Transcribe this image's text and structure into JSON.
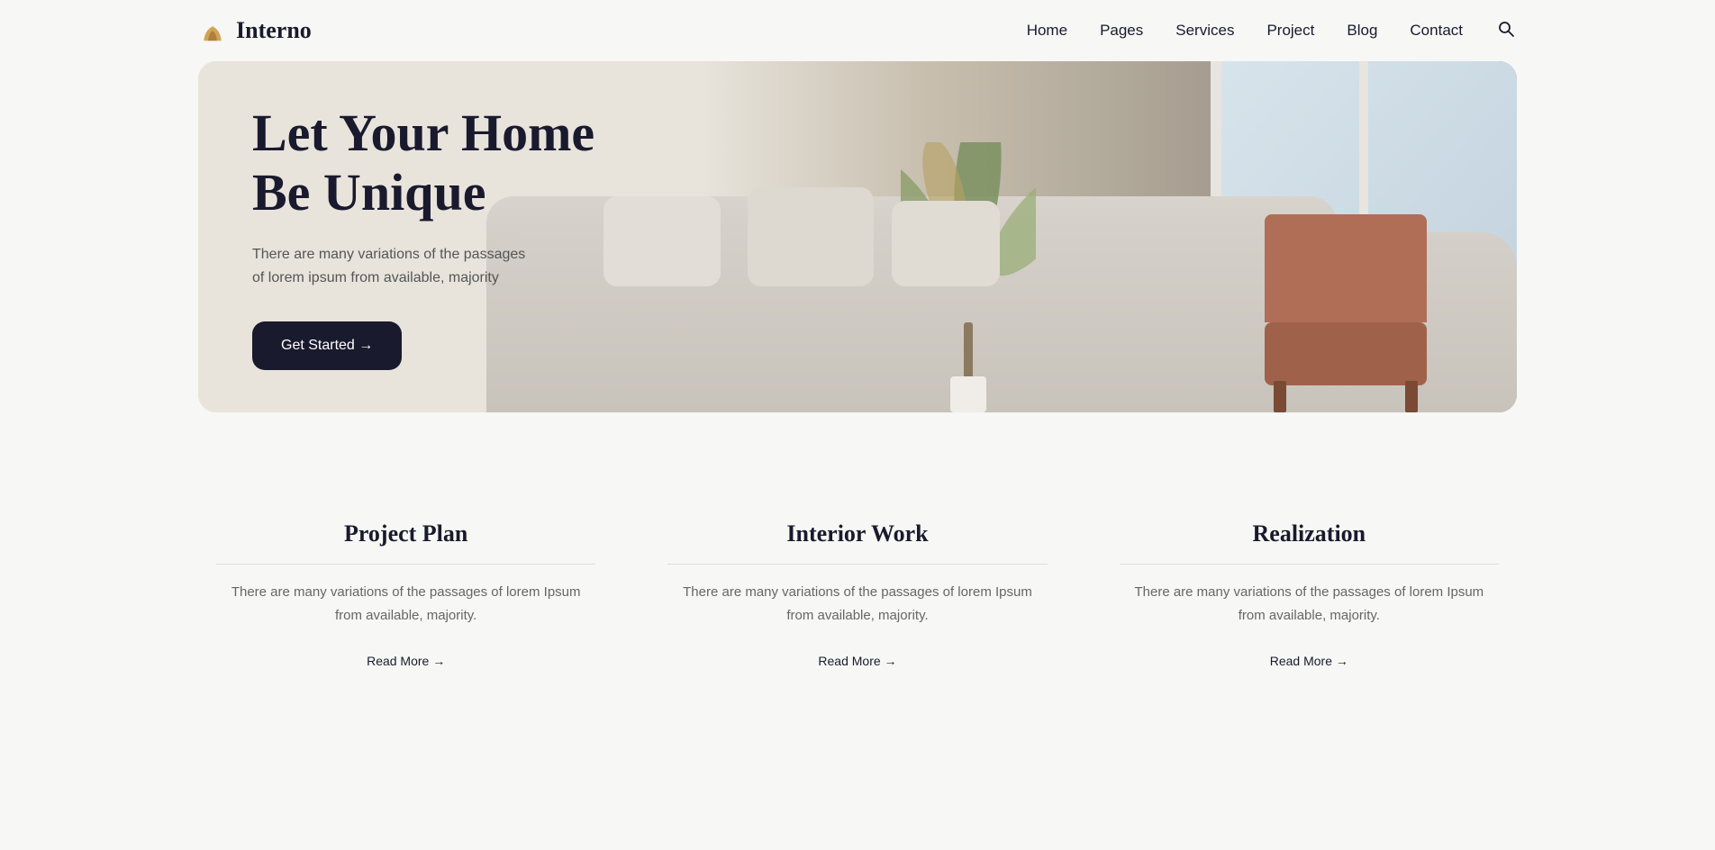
{
  "brand": {
    "name": "Interno",
    "logo_alt": "Interno logo"
  },
  "nav": {
    "items": [
      {
        "label": "Home",
        "href": "#"
      },
      {
        "label": "Pages",
        "href": "#"
      },
      {
        "label": "Services",
        "href": "#"
      },
      {
        "label": "Project",
        "href": "#"
      },
      {
        "label": "Blog",
        "href": "#"
      },
      {
        "label": "Contact",
        "href": "#"
      }
    ],
    "search_aria": "Search"
  },
  "hero": {
    "title_line1": "Let Your Home",
    "title_line2": "Be Unique",
    "subtitle": "There are many variations of the passages\nof lorem ipsum from available, majority",
    "cta_label": "Get Started →"
  },
  "features": [
    {
      "title": "Project Plan",
      "description": "There are many variations of the passages of lorem Ipsum from available, majority.",
      "read_more": "Read More →"
    },
    {
      "title": "Interior Work",
      "description": "There are many variations of the passages of lorem Ipsum from available, majority.",
      "read_more": "Read More →"
    },
    {
      "title": "Realization",
      "description": "There are many variations of the passages of lorem Ipsum from available, majority.",
      "read_more": "Read More →"
    }
  ],
  "colors": {
    "accent": "#c9973a",
    "dark": "#1a1a2e",
    "bg": "#f7f7f5"
  }
}
